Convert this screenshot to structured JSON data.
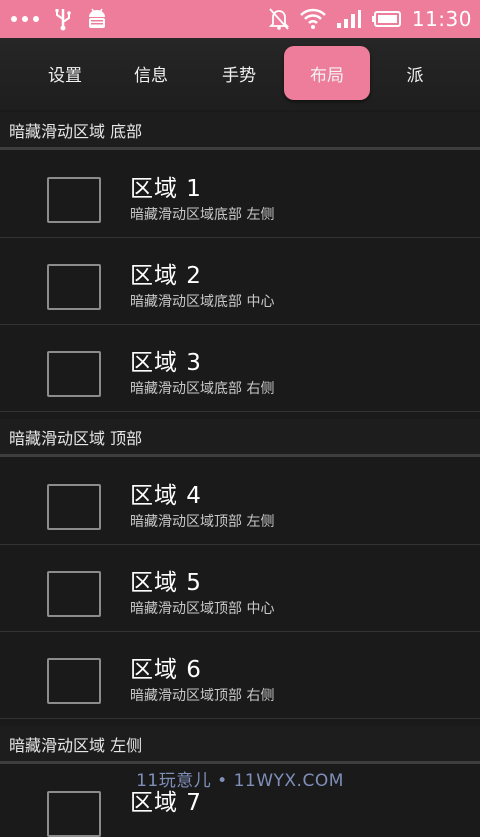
{
  "status_bar": {
    "time": "11:30",
    "left_icons": [
      "more-dots-icon",
      "usb-icon",
      "android-debug-icon"
    ],
    "right_icons": [
      "bell-muted-icon",
      "wifi-icon",
      "signal-icon",
      "battery-icon"
    ],
    "accent": "#ee7d9b"
  },
  "tabs": [
    {
      "label": "设置",
      "active": false
    },
    {
      "label": "信息",
      "active": false
    },
    {
      "label": "手势",
      "active": false
    },
    {
      "label": "布局",
      "active": true
    },
    {
      "label": "派",
      "active": false
    }
  ],
  "sections": [
    {
      "header": "暗藏滑动区域 底部",
      "items": [
        {
          "title": "区域 1",
          "subtitle": "暗藏滑动区域底部 左侧"
        },
        {
          "title": "区域 2",
          "subtitle": "暗藏滑动区域底部 中心"
        },
        {
          "title": "区域 3",
          "subtitle": "暗藏滑动区域底部 右侧"
        }
      ]
    },
    {
      "header": "暗藏滑动区域 顶部",
      "items": [
        {
          "title": "区域 4",
          "subtitle": "暗藏滑动区域顶部 左侧"
        },
        {
          "title": "区域 5",
          "subtitle": "暗藏滑动区域顶部 中心"
        },
        {
          "title": "区域 6",
          "subtitle": "暗藏滑动区域顶部 右侧"
        }
      ]
    },
    {
      "header": "暗藏滑动区域 左侧",
      "items": [
        {
          "title": "区域 7",
          "subtitle": ""
        }
      ]
    }
  ],
  "watermark": "11玩意儿 • 11WYX.COM"
}
